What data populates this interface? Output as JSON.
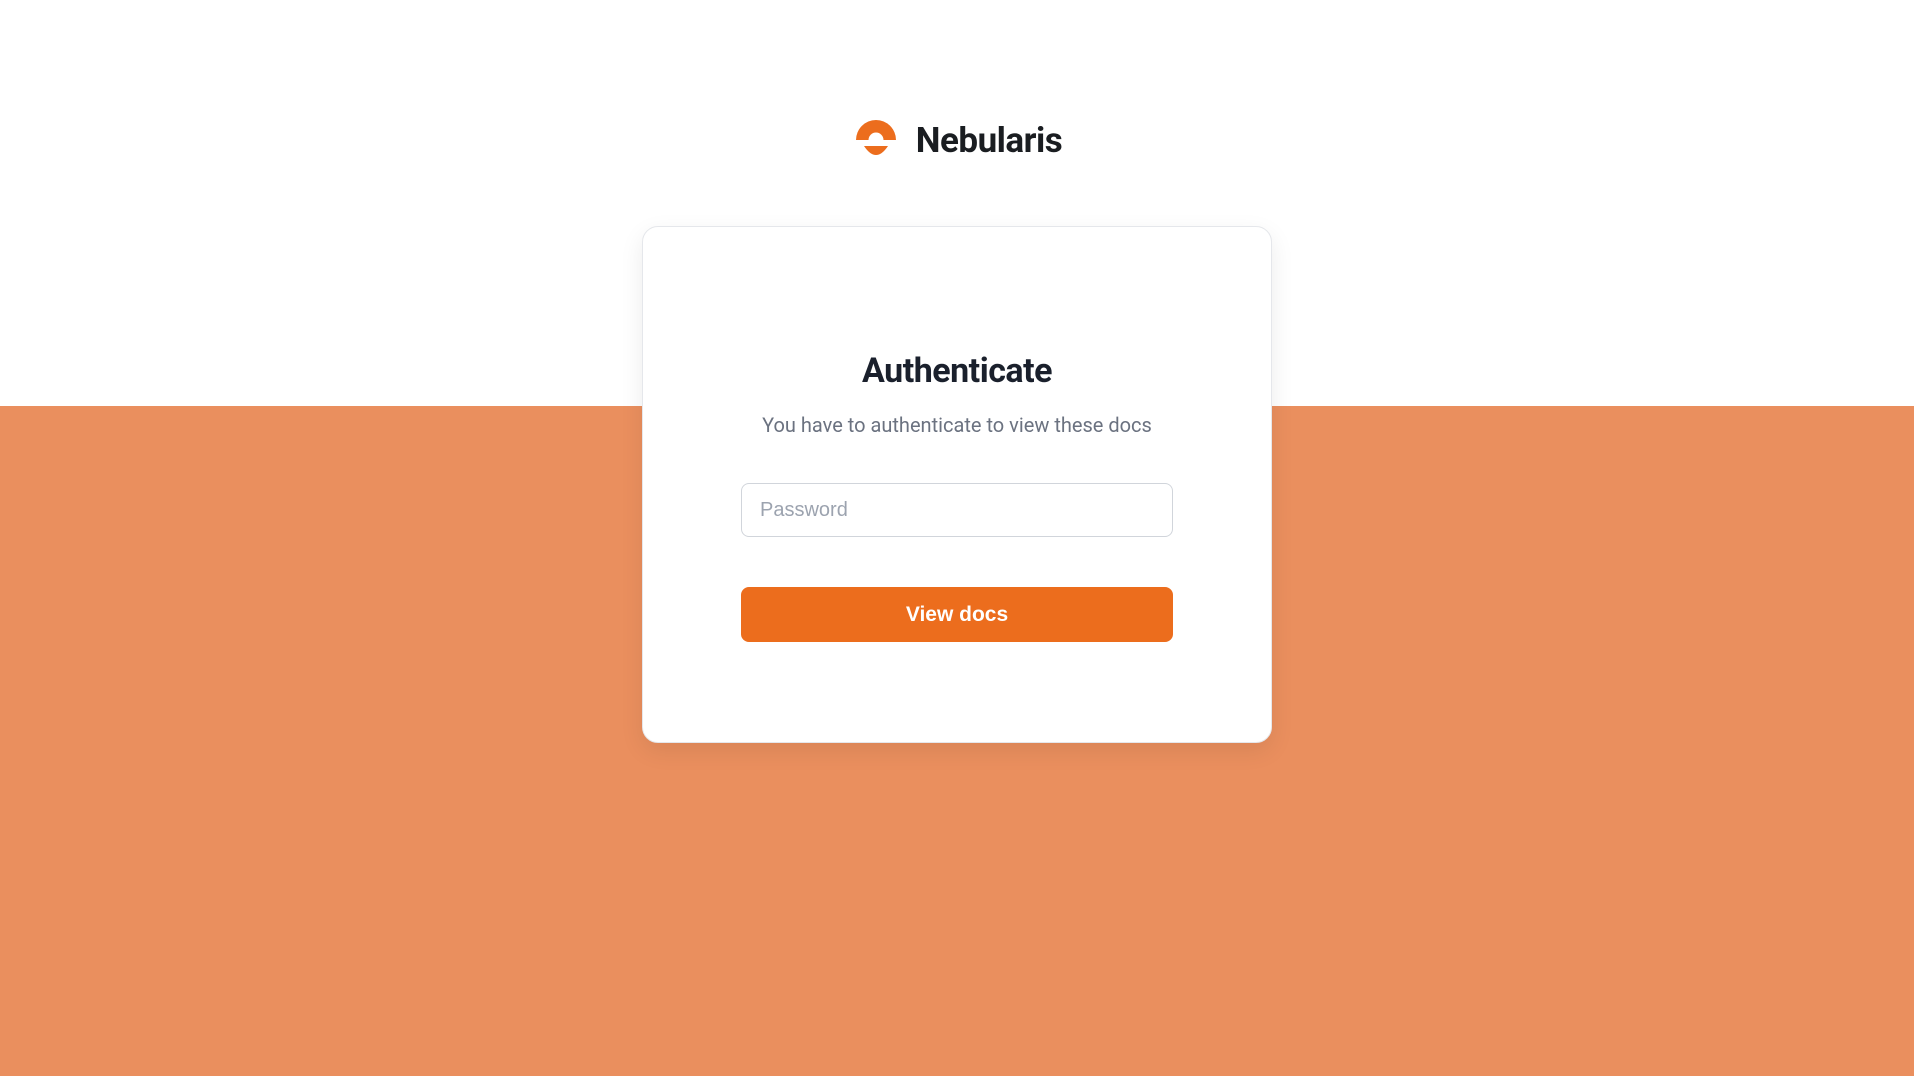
{
  "brand": {
    "name": "Nebularis",
    "logo_color": "#ec6d1d"
  },
  "auth": {
    "title": "Authenticate",
    "subtitle": "You have to authenticate to view these docs",
    "password_placeholder": "Password",
    "submit_label": "View docs"
  },
  "colors": {
    "accent": "#ec6d1d",
    "background_bottom": "#ea8f5e"
  }
}
